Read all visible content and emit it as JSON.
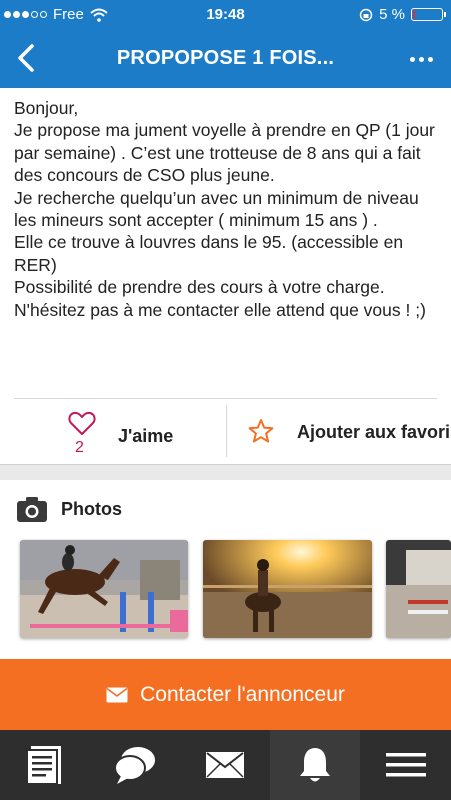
{
  "status_bar": {
    "carrier": "Free",
    "time": "19:48",
    "battery": "5 %",
    "battery_level": 0.05
  },
  "nav": {
    "title": "PROPOPOSE 1 FOIS..."
  },
  "listing": {
    "description": "Bonjour,\nJe propose ma jument voyelle à prendre en QP (1 jour par semaine) . C’est une trotteuse de 8 ans qui a fait des concours de CSO plus jeune.\nJe recherche quelqu’un avec un minimum de niveau les mineurs sont accepter ( minimum 15 ans ) .\nElle ce trouve à louvres dans le 95. (accessible en RER)\nPossibilité de prendre des cours à votre charge.\nN'hésitez pas à me contacter elle attend que vous ! ;)"
  },
  "actions": {
    "like_label": "J'aime",
    "like_count": "2",
    "favorite_label": "Ajouter aux favoris"
  },
  "photos": {
    "title": "Photos",
    "items": [
      "horse-jump-photo",
      "sunset-riding-photo",
      "arena-photo"
    ]
  },
  "contact": {
    "label": "Contacter l'annonceur"
  },
  "tab_bar": {
    "items": [
      "listings-icon",
      "chat-icon",
      "mail-icon",
      "bell-icon",
      "menu-icon"
    ],
    "active": "bell-icon"
  },
  "colors": {
    "primary": "#1c7cc7",
    "accent": "#f46f22",
    "like": "#c2185b",
    "tab_bar": "#2e2e2e"
  }
}
